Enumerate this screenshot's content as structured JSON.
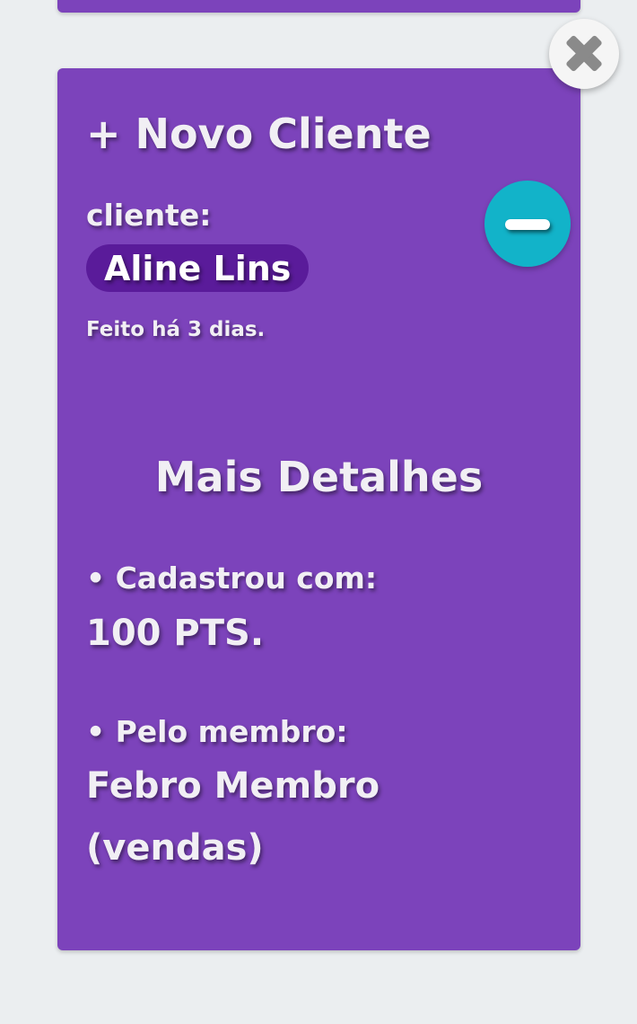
{
  "form": {
    "title": "+ Novo Cliente",
    "client_label": "cliente:",
    "client_name": "Aline Lins",
    "created_text": "Feito há 3 dias."
  },
  "details": {
    "title": "Mais Detalhes",
    "registered_label": "• Cadastrou com:",
    "registered_value": "100 PTS.",
    "member_label": "• Pelo membro:",
    "member_name": "Febro Membro",
    "member_role": "(vendas)"
  },
  "icons": {
    "close": "close-icon",
    "remove": "minus-icon"
  },
  "colors": {
    "card": "#7c43bb",
    "pill": "#5a1b9a",
    "remove_button": "#12b3c9",
    "background": "#ebeef0"
  }
}
